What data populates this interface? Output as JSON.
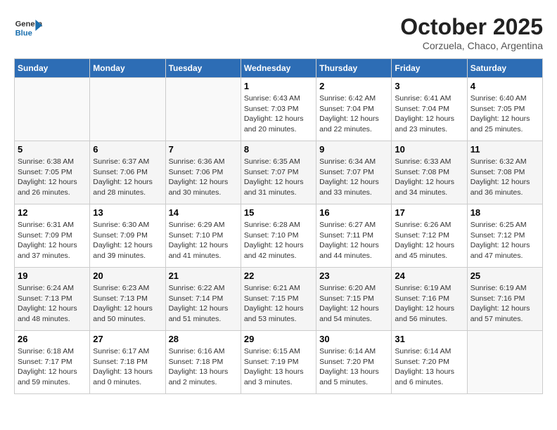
{
  "header": {
    "logo_general": "General",
    "logo_blue": "Blue",
    "month_title": "October 2025",
    "subtitle": "Corzuela, Chaco, Argentina"
  },
  "days_of_week": [
    "Sunday",
    "Monday",
    "Tuesday",
    "Wednesday",
    "Thursday",
    "Friday",
    "Saturday"
  ],
  "weeks": [
    [
      {
        "day": "",
        "info": ""
      },
      {
        "day": "",
        "info": ""
      },
      {
        "day": "",
        "info": ""
      },
      {
        "day": "1",
        "info": "Sunrise: 6:43 AM\nSunset: 7:03 PM\nDaylight: 12 hours\nand 20 minutes."
      },
      {
        "day": "2",
        "info": "Sunrise: 6:42 AM\nSunset: 7:04 PM\nDaylight: 12 hours\nand 22 minutes."
      },
      {
        "day": "3",
        "info": "Sunrise: 6:41 AM\nSunset: 7:04 PM\nDaylight: 12 hours\nand 23 minutes."
      },
      {
        "day": "4",
        "info": "Sunrise: 6:40 AM\nSunset: 7:05 PM\nDaylight: 12 hours\nand 25 minutes."
      }
    ],
    [
      {
        "day": "5",
        "info": "Sunrise: 6:38 AM\nSunset: 7:05 PM\nDaylight: 12 hours\nand 26 minutes."
      },
      {
        "day": "6",
        "info": "Sunrise: 6:37 AM\nSunset: 7:06 PM\nDaylight: 12 hours\nand 28 minutes."
      },
      {
        "day": "7",
        "info": "Sunrise: 6:36 AM\nSunset: 7:06 PM\nDaylight: 12 hours\nand 30 minutes."
      },
      {
        "day": "8",
        "info": "Sunrise: 6:35 AM\nSunset: 7:07 PM\nDaylight: 12 hours\nand 31 minutes."
      },
      {
        "day": "9",
        "info": "Sunrise: 6:34 AM\nSunset: 7:07 PM\nDaylight: 12 hours\nand 33 minutes."
      },
      {
        "day": "10",
        "info": "Sunrise: 6:33 AM\nSunset: 7:08 PM\nDaylight: 12 hours\nand 34 minutes."
      },
      {
        "day": "11",
        "info": "Sunrise: 6:32 AM\nSunset: 7:08 PM\nDaylight: 12 hours\nand 36 minutes."
      }
    ],
    [
      {
        "day": "12",
        "info": "Sunrise: 6:31 AM\nSunset: 7:09 PM\nDaylight: 12 hours\nand 37 minutes."
      },
      {
        "day": "13",
        "info": "Sunrise: 6:30 AM\nSunset: 7:09 PM\nDaylight: 12 hours\nand 39 minutes."
      },
      {
        "day": "14",
        "info": "Sunrise: 6:29 AM\nSunset: 7:10 PM\nDaylight: 12 hours\nand 41 minutes."
      },
      {
        "day": "15",
        "info": "Sunrise: 6:28 AM\nSunset: 7:10 PM\nDaylight: 12 hours\nand 42 minutes."
      },
      {
        "day": "16",
        "info": "Sunrise: 6:27 AM\nSunset: 7:11 PM\nDaylight: 12 hours\nand 44 minutes."
      },
      {
        "day": "17",
        "info": "Sunrise: 6:26 AM\nSunset: 7:12 PM\nDaylight: 12 hours\nand 45 minutes."
      },
      {
        "day": "18",
        "info": "Sunrise: 6:25 AM\nSunset: 7:12 PM\nDaylight: 12 hours\nand 47 minutes."
      }
    ],
    [
      {
        "day": "19",
        "info": "Sunrise: 6:24 AM\nSunset: 7:13 PM\nDaylight: 12 hours\nand 48 minutes."
      },
      {
        "day": "20",
        "info": "Sunrise: 6:23 AM\nSunset: 7:13 PM\nDaylight: 12 hours\nand 50 minutes."
      },
      {
        "day": "21",
        "info": "Sunrise: 6:22 AM\nSunset: 7:14 PM\nDaylight: 12 hours\nand 51 minutes."
      },
      {
        "day": "22",
        "info": "Sunrise: 6:21 AM\nSunset: 7:15 PM\nDaylight: 12 hours\nand 53 minutes."
      },
      {
        "day": "23",
        "info": "Sunrise: 6:20 AM\nSunset: 7:15 PM\nDaylight: 12 hours\nand 54 minutes."
      },
      {
        "day": "24",
        "info": "Sunrise: 6:19 AM\nSunset: 7:16 PM\nDaylight: 12 hours\nand 56 minutes."
      },
      {
        "day": "25",
        "info": "Sunrise: 6:19 AM\nSunset: 7:16 PM\nDaylight: 12 hours\nand 57 minutes."
      }
    ],
    [
      {
        "day": "26",
        "info": "Sunrise: 6:18 AM\nSunset: 7:17 PM\nDaylight: 12 hours\nand 59 minutes."
      },
      {
        "day": "27",
        "info": "Sunrise: 6:17 AM\nSunset: 7:18 PM\nDaylight: 13 hours\nand 0 minutes."
      },
      {
        "day": "28",
        "info": "Sunrise: 6:16 AM\nSunset: 7:18 PM\nDaylight: 13 hours\nand 2 minutes."
      },
      {
        "day": "29",
        "info": "Sunrise: 6:15 AM\nSunset: 7:19 PM\nDaylight: 13 hours\nand 3 minutes."
      },
      {
        "day": "30",
        "info": "Sunrise: 6:14 AM\nSunset: 7:20 PM\nDaylight: 13 hours\nand 5 minutes."
      },
      {
        "day": "31",
        "info": "Sunrise: 6:14 AM\nSunset: 7:20 PM\nDaylight: 13 hours\nand 6 minutes."
      },
      {
        "day": "",
        "info": ""
      }
    ]
  ]
}
